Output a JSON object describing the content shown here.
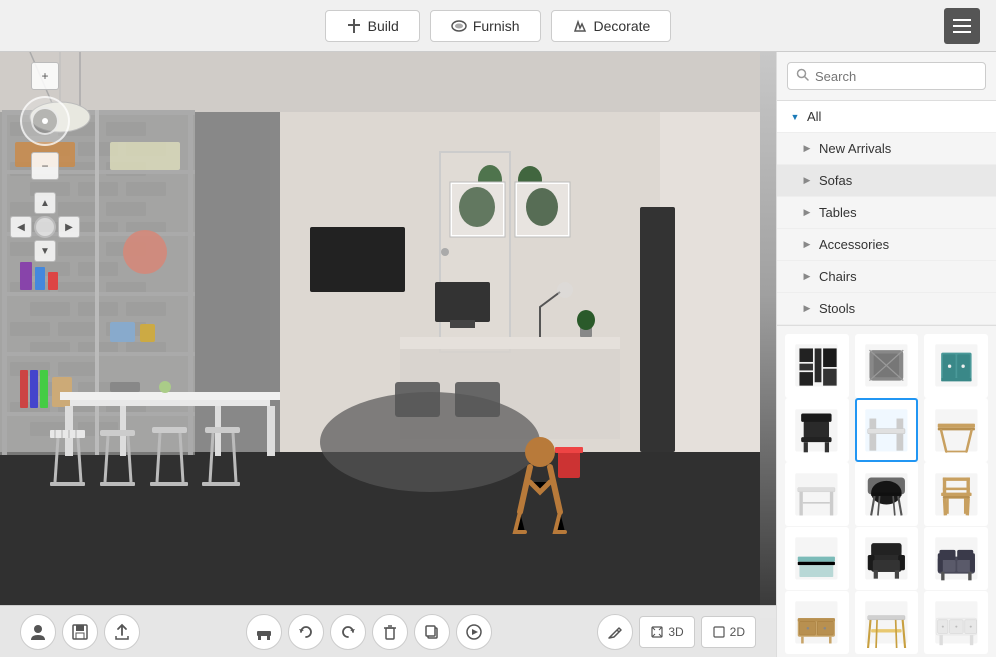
{
  "toolbar": {
    "build_label": "Build",
    "furnish_label": "Furnish",
    "decorate_label": "Decorate"
  },
  "search": {
    "placeholder": "Search"
  },
  "categories": [
    {
      "id": "all",
      "label": "All",
      "expanded": true,
      "arrow": "▼"
    },
    {
      "id": "new-arrivals",
      "label": "New Arrivals",
      "expanded": false,
      "arrow": "▶"
    },
    {
      "id": "sofas",
      "label": "Sofas",
      "expanded": false,
      "arrow": "▶"
    },
    {
      "id": "tables",
      "label": "Tables",
      "expanded": false,
      "arrow": "▶"
    },
    {
      "id": "accessories",
      "label": "Accessories",
      "expanded": false,
      "arrow": "▶"
    },
    {
      "id": "chairs",
      "label": "Chairs",
      "expanded": false,
      "arrow": "▶"
    },
    {
      "id": "stools",
      "label": "Stools",
      "expanded": false,
      "arrow": "▶"
    }
  ],
  "products": [
    {
      "id": "p1",
      "label": "Wall Art Black",
      "selected": false
    },
    {
      "id": "p2",
      "label": "Cushion",
      "selected": false
    },
    {
      "id": "p3",
      "label": "Cabinet Teal",
      "selected": false
    },
    {
      "id": "p4",
      "label": "Chair Dark",
      "selected": false
    },
    {
      "id": "p5",
      "label": "Coffee Table",
      "selected": true
    },
    {
      "id": "p6",
      "label": "Side Table Wood",
      "selected": false
    },
    {
      "id": "p7",
      "label": "White Table",
      "selected": false
    },
    {
      "id": "p8",
      "label": "Chair Black",
      "selected": false
    },
    {
      "id": "p9",
      "label": "Chair Natural",
      "selected": false
    },
    {
      "id": "p10",
      "label": "Teal Table",
      "selected": false
    },
    {
      "id": "p11",
      "label": "Armchair Dark",
      "selected": false
    },
    {
      "id": "p12",
      "label": "Sofa Grey",
      "selected": false
    },
    {
      "id": "p13",
      "label": "Sideboard Wood",
      "selected": false
    },
    {
      "id": "p14",
      "label": "Console Table",
      "selected": false
    },
    {
      "id": "p15",
      "label": "TV Unit White",
      "selected": false
    }
  ],
  "bottom_controls": {
    "profile": "👤",
    "save": "💾",
    "upload": "⬆",
    "furniture": "🪑",
    "undo": "↺",
    "redo": "↻",
    "delete": "🗑",
    "copy": "⧉",
    "play": "▶",
    "pencil": "✏",
    "view3d": "3D",
    "view2d": "2D"
  },
  "viewport_controls": {
    "zoom_in": "+",
    "zoom_out": "−",
    "up": "▲",
    "down": "▼",
    "left": "◀",
    "right": "▶"
  }
}
